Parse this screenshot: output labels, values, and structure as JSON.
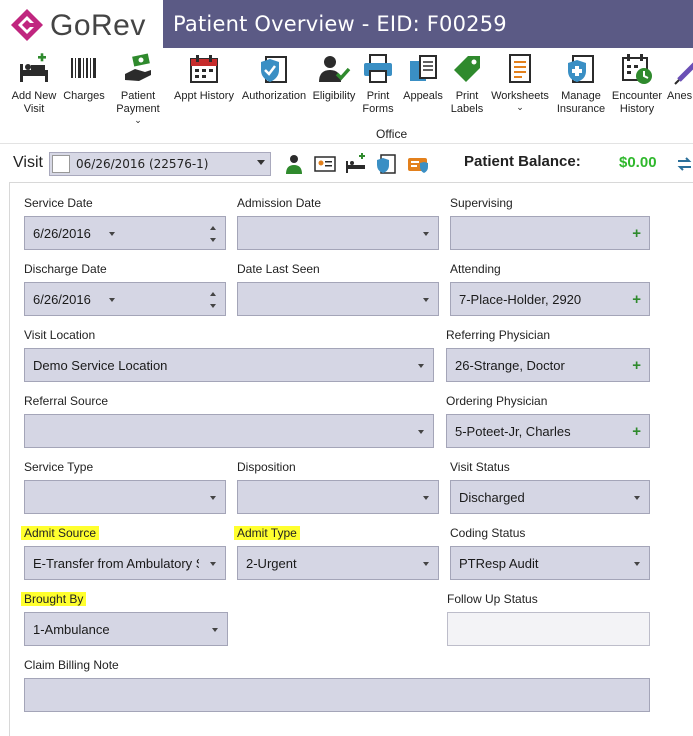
{
  "app": {
    "logo_text": "GoRev",
    "title": "Patient Overview - EID: F00259"
  },
  "colors": {
    "brand": "#5b5a85",
    "logo_accent": "#c0267f",
    "balance": "#2fb82c",
    "field_bg": "#d5d6e4",
    "highlight": "#ffff2e"
  },
  "toolbar": {
    "items": [
      {
        "line1": "Add New",
        "line2": "Visit",
        "icon": "bed-plus-icon"
      },
      {
        "line1": "Charges",
        "line2": "",
        "icon": "barcode-icon"
      },
      {
        "line1": "Patient",
        "line2": "Payment",
        "icon": "money-hand-icon",
        "dropdown": true
      },
      {
        "line1": "Appt History",
        "line2": "",
        "icon": "calendar-icon"
      },
      {
        "line1": "Authorization",
        "line2": "",
        "icon": "shield-clipboard-icon"
      },
      {
        "line1": "Eligibility",
        "line2": "",
        "icon": "user-check-icon"
      },
      {
        "line1": "Print",
        "line2": "Forms",
        "icon": "printer-icon"
      },
      {
        "line1": "Appeals",
        "line2": "",
        "icon": "documents-icon"
      },
      {
        "line1": "Print",
        "line2": "Labels",
        "icon": "tag-icon"
      },
      {
        "line1": "Worksheets",
        "line2": "",
        "icon": "worksheet-icon",
        "dropdown": true
      },
      {
        "line1": "Manage",
        "line2": "Insurance",
        "icon": "insurance-card-icon"
      },
      {
        "line1": "Encounter",
        "line2": "History",
        "icon": "calendar-clock-icon"
      },
      {
        "line1": "Anes",
        "line2": "",
        "icon": "syringe-icon"
      }
    ],
    "group_label": "Office"
  },
  "visit": {
    "label": "Visit",
    "selected": "06/26/2016 (22576-1)",
    "balance_label": "Patient Balance:",
    "balance_value": "$0.00"
  },
  "form": {
    "service_date": {
      "label": "Service Date",
      "value": "6/26/2016"
    },
    "admission_date": {
      "label": "Admission Date",
      "value": ""
    },
    "supervising": {
      "label": "Supervising",
      "value": ""
    },
    "discharge_date": {
      "label": "Discharge Date",
      "value": "6/26/2016"
    },
    "date_last_seen": {
      "label": "Date Last Seen",
      "value": ""
    },
    "attending": {
      "label": "Attending",
      "value": "7-Place-Holder, 2920"
    },
    "visit_location": {
      "label": "Visit Location",
      "value": "Demo Service Location"
    },
    "referring_physician": {
      "label": "Referring Physician",
      "value": "26-Strange, Doctor"
    },
    "referral_source": {
      "label": "Referral Source",
      "value": ""
    },
    "ordering_physician": {
      "label": "Ordering Physician",
      "value": "5-Poteet-Jr, Charles"
    },
    "service_type": {
      "label": "Service Type",
      "value": ""
    },
    "disposition": {
      "label": "Disposition",
      "value": ""
    },
    "visit_status": {
      "label": "Visit Status",
      "value": "Discharged"
    },
    "admit_source": {
      "label": "Admit Source",
      "value": "E-Transfer from Ambulatory S"
    },
    "admit_type": {
      "label": "Admit Type",
      "value": "2-Urgent"
    },
    "coding_status": {
      "label": "Coding Status",
      "value": "PTResp Audit"
    },
    "brought_by": {
      "label": "Brought By",
      "value": "1-Ambulance"
    },
    "follow_up_status": {
      "label": "Follow Up Status",
      "value": ""
    },
    "claim_billing_note": {
      "label": "Claim Billing Note",
      "value": ""
    }
  }
}
